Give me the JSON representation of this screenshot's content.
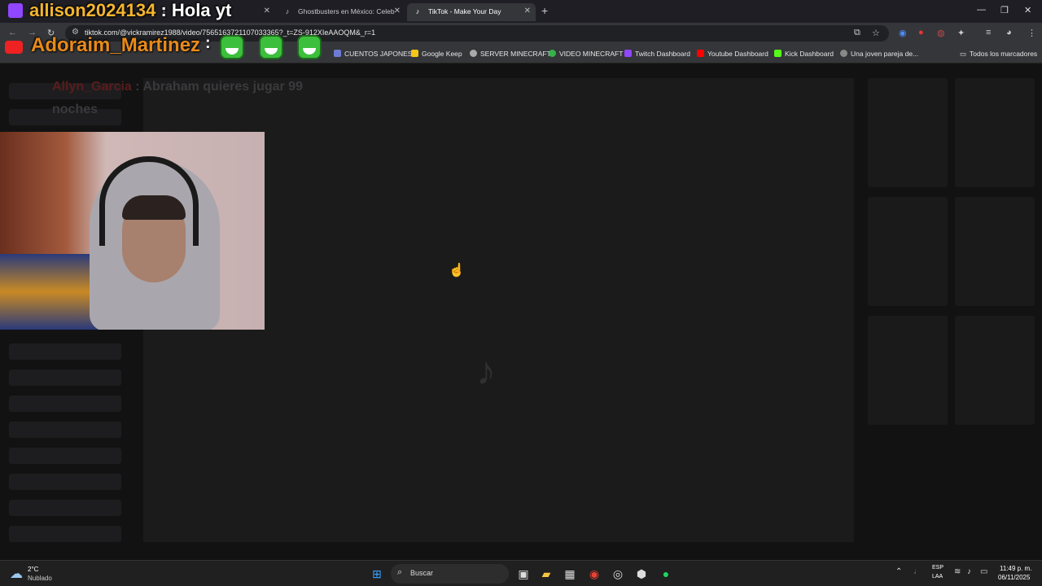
{
  "browser": {
    "tabs": [
      {
        "title": "",
        "favicon": "twitch-icon",
        "active": false
      },
      {
        "title": "Ghostbusters en México: Celeb",
        "favicon": "tiktok-icon",
        "active": false
      },
      {
        "title": "TikTok - Make Your Day",
        "favicon": "tiktok-icon",
        "active": true
      }
    ],
    "close_glyph": "✕",
    "new_tab_glyph": "+",
    "url": "tiktok.com/@vickramirez1988/video/7565163721107033365?_t=ZS-912XIeAAOQM&_r=1",
    "bookmarks": [
      {
        "label": "CUENTOS JAPONES",
        "color": "#6e7bd6"
      },
      {
        "label": "Google Keep",
        "color": "#f5c518"
      },
      {
        "label": "SERVER MINECRAFT",
        "color": "#aaaaaa"
      },
      {
        "label": "VIDEO MINECRAFT",
        "color": "#35b34a"
      },
      {
        "label": "Twitch Dashboard",
        "color": "#9146ff"
      },
      {
        "label": "Youtube Dashboard",
        "color": "#ff0000"
      },
      {
        "label": "Kick Dashboard",
        "color": "#53fc18"
      },
      {
        "label": "Una joven pareja de...",
        "color": "#888888"
      }
    ],
    "all_bookmarks": "Todos los marcadores"
  },
  "overlay": {
    "chat_user": "allison2024134",
    "chat_sep": ":",
    "chat_message": "Hola yt",
    "name": "Adoraim_Martinez",
    "name_sep": ":",
    "ghost_user": "Allyn_Garcia",
    "ghost_message": ": Abraham quieres jugar 99",
    "ghost_message_2": "noches"
  },
  "taskbar": {
    "temperature": "2°C",
    "weather": "Nublado",
    "search_placeholder": "Buscar",
    "lang_1": "ESP",
    "lang_2": "LAA",
    "time": "11:49 p. m.",
    "date": "06/11/2025"
  }
}
